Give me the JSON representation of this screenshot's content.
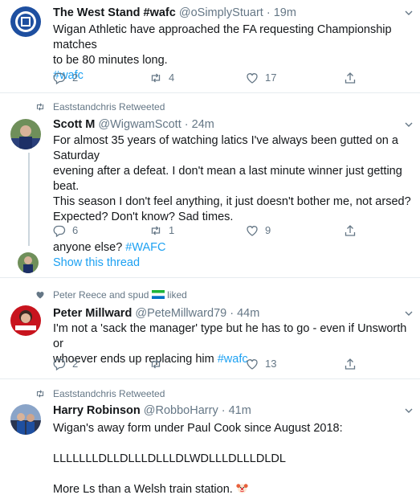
{
  "tweets": [
    {
      "name": "The West Stand #wafc",
      "handle": "@oSimplyStuart",
      "time": "19m",
      "lines": [
        "Wigan Athletic have approached the FA requesting Championship matches",
        "to be 80 minutes long."
      ],
      "hashtag": "#wafc",
      "replies": "2",
      "retweets": "4",
      "likes": "17"
    },
    {
      "social": "Eaststandchris Retweeted",
      "name": "Scott M",
      "handle": "@WigwamScott",
      "time": "24m",
      "lines": [
        "For almost 35 years of watching latics I've always been gutted on a Saturday",
        "evening after a defeat. I don't mean a last minute winner just getting beat.",
        "This season I don't feel anything, it just doesn't bother me, not arsed?",
        "Expected?  Don't know? Sad times."
      ],
      "last_line": "anyone else?",
      "hashtag": "#WAFC",
      "replies": "6",
      "retweets": "1",
      "likes": "9",
      "show_thread": "Show this thread"
    },
    {
      "social": "Peter Reece and spud",
      "social_suffix": "liked",
      "name": "Peter Millward",
      "handle": "@PeteMillward79",
      "time": "44m",
      "lines": [
        "I'm not a 'sack the manager' type but he has to go - even if Unsworth or"
      ],
      "line2_prefix": "whoever ends up replacing him",
      "hashtag": "#wafc",
      "replies": "2",
      "retweets": "",
      "likes": "13"
    },
    {
      "social": "Eaststandchris Retweeted",
      "name": "Harry Robinson",
      "handle": "@RobboHarry",
      "time": "41m",
      "lines": [
        "Wigan's away form under Paul Cook since August 2018:"
      ],
      "form": "LLLLLLLDLLDLLLDLLLDLWDLLLDLLLDLDL",
      "last": "More Ls than a Welsh train station."
    }
  ],
  "colors": {
    "link": "#1da1f2",
    "meta": "#657786",
    "text": "#14171a",
    "border": "#e6ecf0"
  }
}
